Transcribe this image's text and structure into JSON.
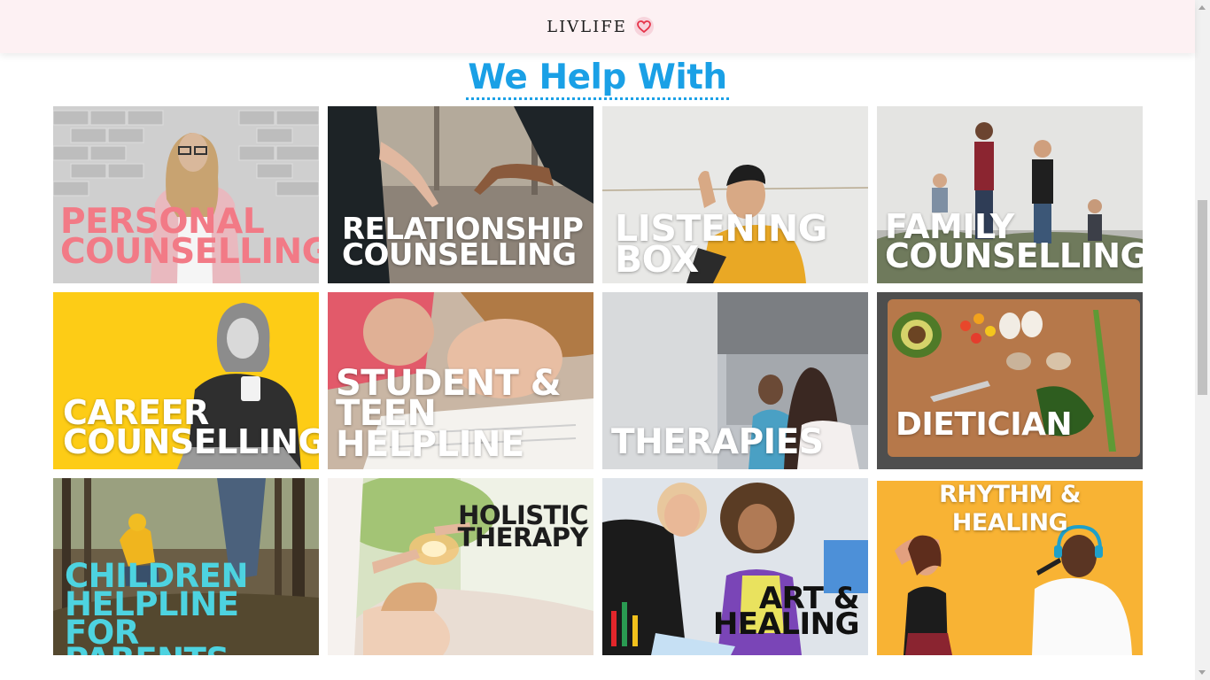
{
  "brand": {
    "name": "LIVLIFE",
    "icon": "heart-icon",
    "accent": "#e6344a"
  },
  "section": {
    "title": "We Help With",
    "title_color": "#1aa0e6"
  },
  "services": [
    {
      "id": "personal-counselling",
      "lines": [
        "PERSONAL",
        "COUNSELLING"
      ],
      "label_color": "#f27a86"
    },
    {
      "id": "relationship-counselling",
      "lines": [
        "RELATIONSHIP",
        "COUNSELLING"
      ],
      "label_color": "#ffffff"
    },
    {
      "id": "listening-box",
      "lines": [
        "LISTENING",
        "BOX"
      ],
      "label_color": "#ffffff"
    },
    {
      "id": "family-counselling",
      "lines": [
        "FAMILY",
        "COUNSELLING"
      ],
      "label_color": "#ffffff"
    },
    {
      "id": "career-counselling",
      "lines": [
        "CAREER",
        "COUNSELLING"
      ],
      "label_color": "#ffffff"
    },
    {
      "id": "student-teen-helpline",
      "lines": [
        "STUDENT &",
        "TEEN",
        "HELPLINE"
      ],
      "label_color": "#ffffff"
    },
    {
      "id": "therapies",
      "lines": [
        "THERAPIES"
      ],
      "label_color": "#ffffff"
    },
    {
      "id": "dietician",
      "lines": [
        "DIETICIAN"
      ],
      "label_color": "#ffffff"
    },
    {
      "id": "children-helpline",
      "lines": [
        "CHILDREN",
        "HELPLINE FOR",
        "PARENTS"
      ],
      "label_color": "#4dd3e0"
    },
    {
      "id": "holistic-therapy",
      "lines": [
        "HOLISTIC",
        "THERAPY"
      ],
      "label_color": "#1d1d1d"
    },
    {
      "id": "art-healing",
      "lines": [
        "ART &",
        "HEALING"
      ],
      "label_color": "#111111"
    },
    {
      "id": "rhythm-healing",
      "lines": [
        "RHYTHM &",
        "HEALING"
      ],
      "label_color": "#ffffff"
    }
  ]
}
